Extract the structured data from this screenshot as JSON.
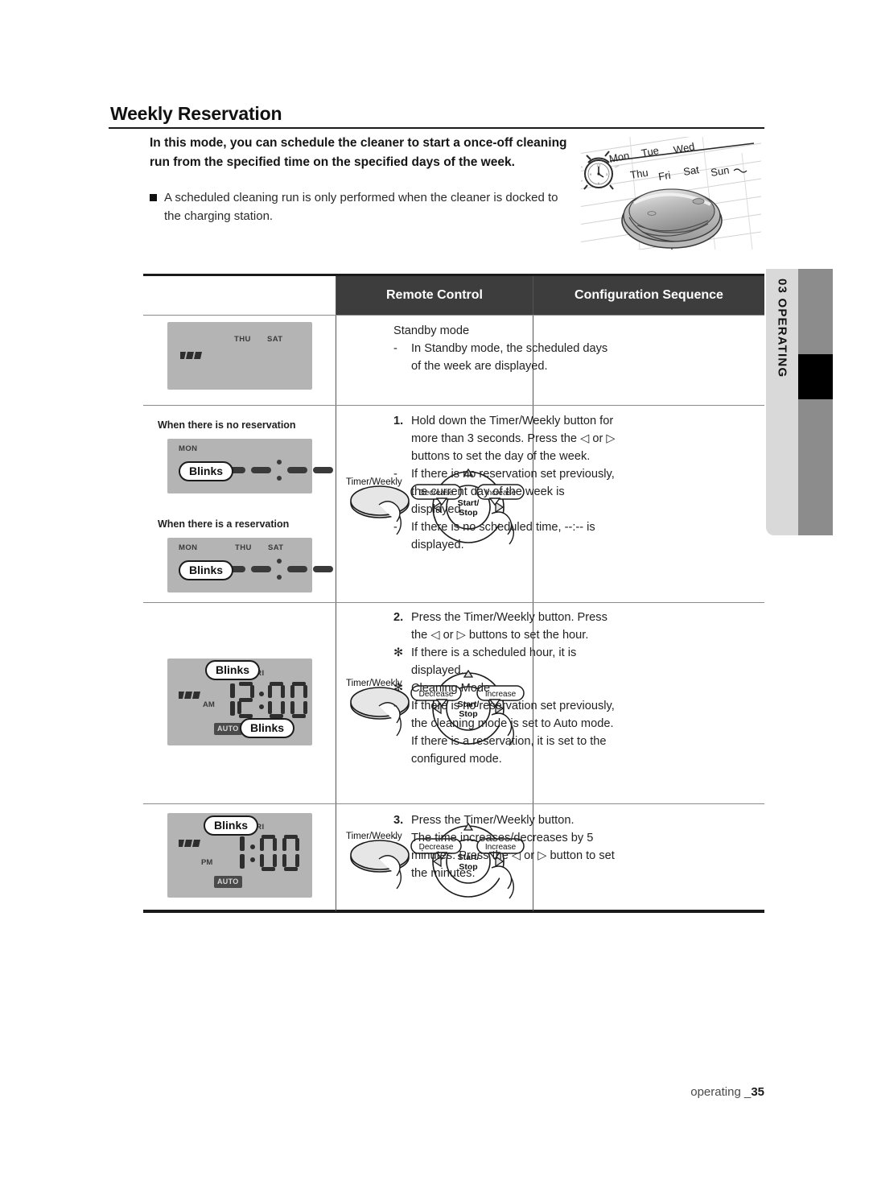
{
  "page": {
    "title": "Weekly Reservation",
    "intro_bold": "In this mode, you can schedule the cleaner to start a once-off cleaning run from the specified time on the specified days of the week.",
    "bullet": "A scheduled cleaning run is only performed when the cleaner is docked to the charging station.",
    "footer_label": "operating _",
    "footer_page": "35"
  },
  "hero": {
    "days": [
      "Mon",
      "Tue",
      "Wed",
      "Thu",
      "Fri",
      "Sat",
      "Sun"
    ],
    "clock_icon": "alarm-clock-icon",
    "robot_icon": "robot-vacuum-icon"
  },
  "side_tab": {
    "number": "03",
    "label": "OPERATING",
    "text": "03  OPERATING",
    "light_color": "#d9d9d9",
    "dark_color": "#8c8c8c",
    "marker_color": "#000000"
  },
  "table": {
    "headers": {
      "col1": "",
      "col2": "Remote Control",
      "col3": "Configuration Sequence"
    },
    "header_bg": "#3d3d3d",
    "header_fg": "#ffffff",
    "rows": [
      {
        "id": "row-standby",
        "lcd": {
          "battery": "battery-icon",
          "days": [
            "THU",
            "SAT"
          ],
          "ampm": "",
          "time": "",
          "mode_badge": ""
        },
        "remote": null,
        "sequence": {
          "lead": "Standby mode",
          "items": [
            {
              "marker": "-",
              "text": "In Standby mode, the scheduled days of the week are displayed."
            }
          ]
        }
      },
      {
        "id": "row-step-1",
        "sub_panels": [
          {
            "caption": "When there is no reservation",
            "day_active": "MON",
            "days_extra": [],
            "callout": "Blinks",
            "time_display": "--:--"
          },
          {
            "caption": "When there is a reservation",
            "day_active": "MON",
            "days_extra": [
              "THU",
              "SAT"
            ],
            "callout": "Blinks",
            "time_display": "--:--"
          }
        ],
        "remote": {
          "timer_label": "Timer/Weekly",
          "decrease_label": "Decrease",
          "increase_label": "Increase",
          "center_label": "Start/\nStop",
          "center_line1": "Start/",
          "center_line2": "Stop"
        },
        "sequence": {
          "items": [
            {
              "marker": "1.",
              "text": "Hold down the Timer/Weekly button for more than 3 seconds. Press the ◁ or ▷ buttons to set the day of the week."
            },
            {
              "marker": "-",
              "text": "If there is no reservation set previously, the current day of the week is displayed."
            },
            {
              "marker": "-",
              "text": "If there is no scheduled time, --:-- is displayed."
            }
          ]
        }
      },
      {
        "id": "row-step-2",
        "lcd": {
          "battery": "battery-icon",
          "day": "FRI",
          "ampm": "AM",
          "time": "12:00",
          "mode_badge": "AUTO",
          "callout_top": "Blinks",
          "callout_bottom": "Blinks"
        },
        "remote": {
          "timer_label": "Timer/Weekly",
          "decrease_label": "Decrease",
          "increase_label": "Increase",
          "center_line1": "Start/",
          "center_line2": "Stop"
        },
        "sequence": {
          "items": [
            {
              "marker": "2.",
              "text": "Press the Timer/Weekly button. Press the ◁ or ▷ buttons to set the hour."
            },
            {
              "marker": "✻",
              "text": "If there is a scheduled hour, it is displayed."
            },
            {
              "marker": "✻",
              "text": "Cleaning Mode"
            },
            {
              "marker": "-",
              "text": "If there is no reservation set previously, the cleaning mode is set to Auto mode. If there is a reservation, it is set to the configured mode."
            }
          ]
        }
      },
      {
        "id": "row-step-3",
        "lcd": {
          "battery": "battery-icon",
          "day": "FRI",
          "ampm": "PM",
          "time": "1:00",
          "mode_badge": "AUTO",
          "callout_top": "Blinks"
        },
        "remote": {
          "timer_label": "Timer/Weekly",
          "decrease_label": "Decrease",
          "increase_label": "Increase",
          "center_line1": "Start/",
          "center_line2": "Stop"
        },
        "sequence": {
          "items": [
            {
              "marker": "3.",
              "text": "Press the Timer/Weekly button."
            },
            {
              "marker": "-",
              "text": "The time increases/decreases by 5 minutes. Press the ◁ or ▷ button to set the minutes."
            }
          ]
        }
      }
    ]
  }
}
